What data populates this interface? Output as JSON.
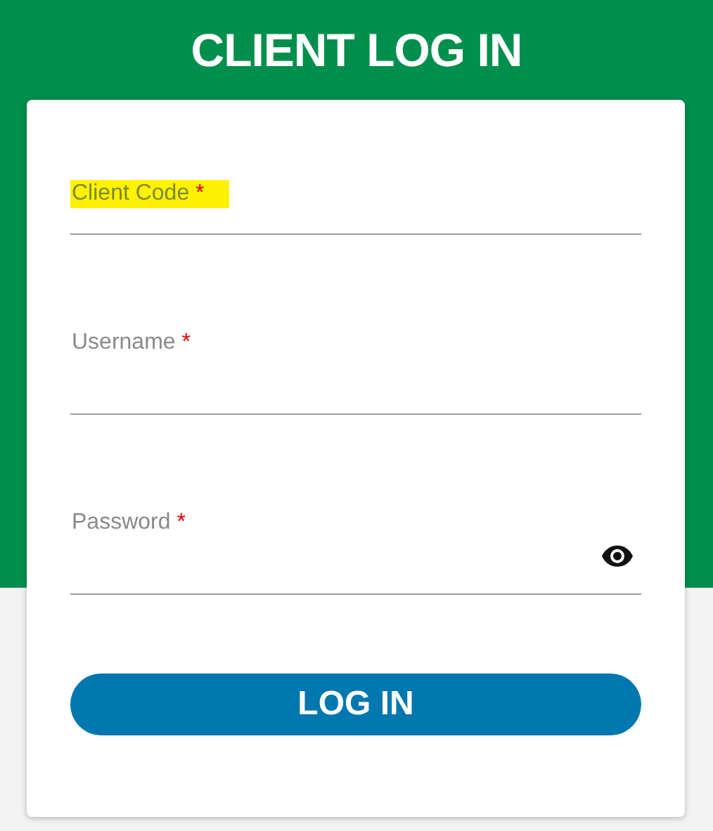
{
  "title": "CLIENT LOG IN",
  "fields": [
    {
      "kind": "text",
      "label": "Client Code",
      "required_mark": "*",
      "highlighted": true
    },
    {
      "kind": "text",
      "label": "Username",
      "required_mark": "*",
      "highlighted": false
    },
    {
      "kind": "password",
      "label": "Password",
      "required_mark": "*",
      "highlighted": false
    }
  ],
  "button": "LOG IN"
}
